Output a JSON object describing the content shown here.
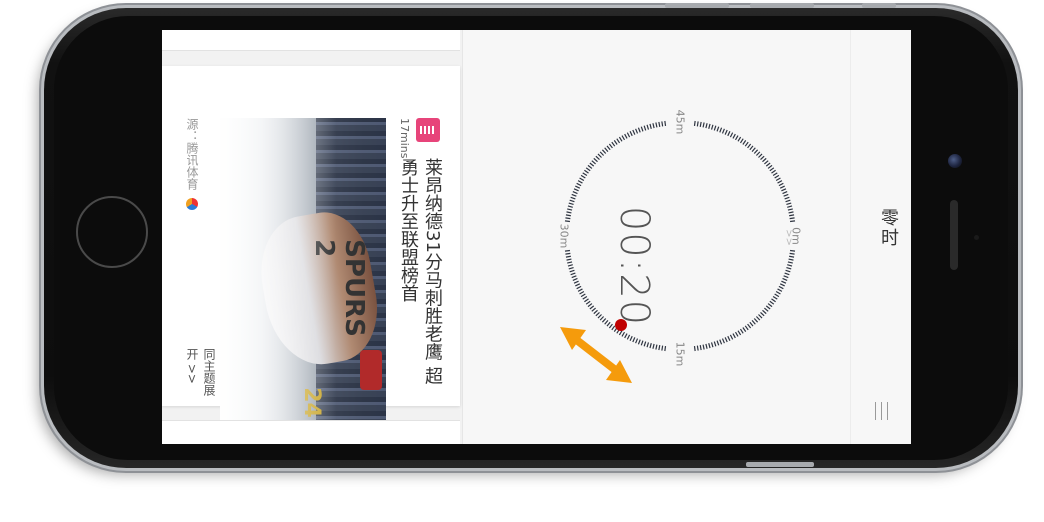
{
  "app": {
    "title": "零时"
  },
  "feed": {
    "card": {
      "source_time": "17mins",
      "headline": "莱昂纳德31分马刺胜老鹰 超勇士升至联盟榜首",
      "source": "源：腾讯体育",
      "expand_label": "同主题展开 >>",
      "source_icon_color": "#e7447a"
    }
  },
  "timer": {
    "readout": "00:20",
    "tick_labels": [
      "0m",
      "15m",
      "30m",
      "45m"
    ],
    "progress_marker_color": "#c00000",
    "ring_color": "#2e3440"
  },
  "overlay": {
    "arrow_color": "#f59b0c"
  },
  "nav": {
    "menu_icon": "menu-icon"
  }
}
